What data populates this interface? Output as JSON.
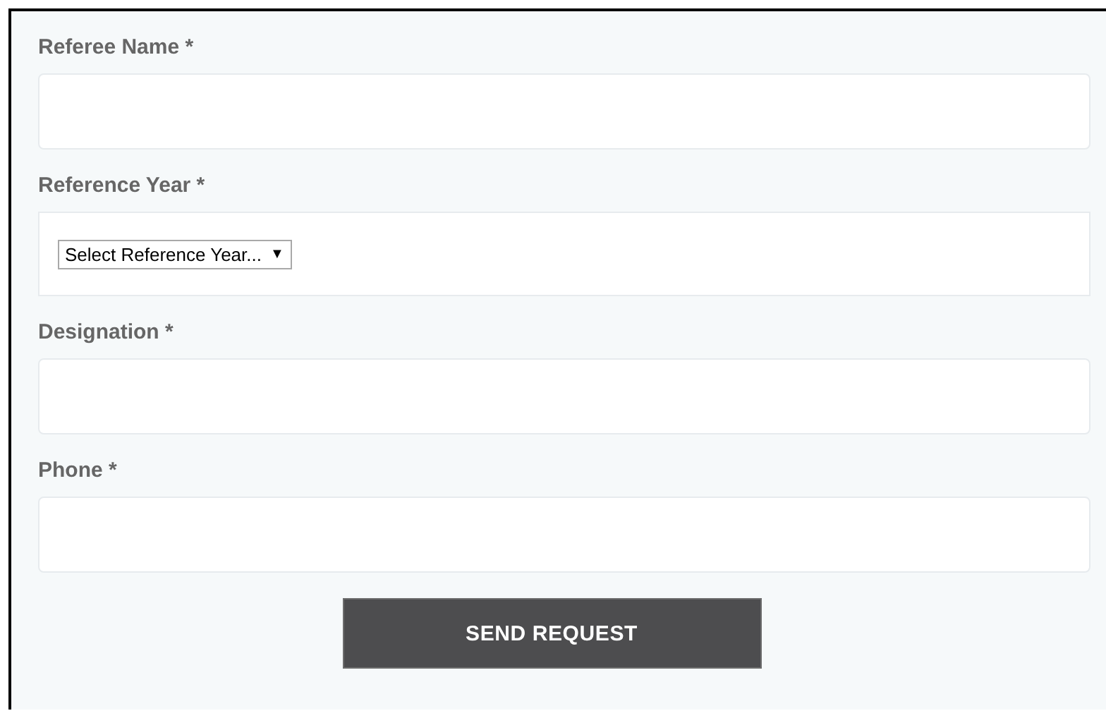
{
  "fields": [
    {
      "kind": "text",
      "label": "Referee Name *"
    },
    {
      "kind": "select",
      "label": "Reference Year *",
      "value": "Select Reference Year...",
      "caret": "▼"
    },
    {
      "kind": "text",
      "label": "Designation *"
    },
    {
      "kind": "text",
      "label": "Phone *"
    }
  ],
  "submit": {
    "label": "SEND REQUEST"
  }
}
